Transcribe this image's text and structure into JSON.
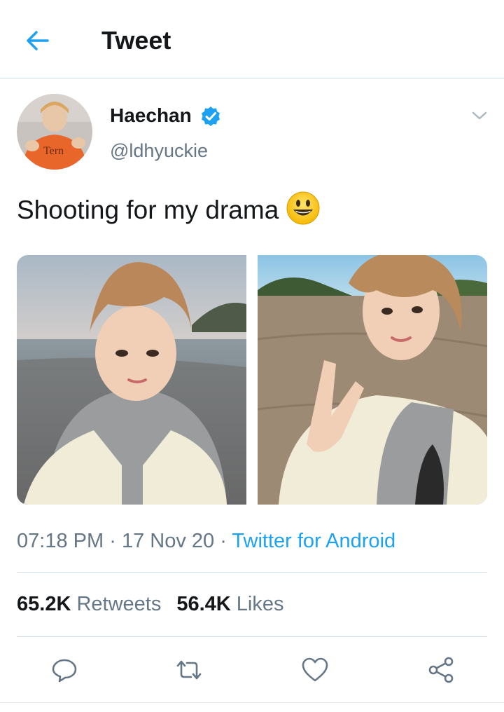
{
  "header": {
    "title": "Tweet",
    "back_icon": "arrow-left-icon"
  },
  "author": {
    "name": "Haechan",
    "handle": "@ldhyuckie",
    "verified": true,
    "verified_icon": "verified-badge-icon",
    "avatar_shirt_text": "Tern"
  },
  "tweet": {
    "text": "Shooting for my drama",
    "emoji": "smiley-face-emoji"
  },
  "meta": {
    "time": "07:18 PM",
    "separator": "·",
    "date": "17 Nov 20",
    "source": "Twitter for Android"
  },
  "stats": {
    "retweets_count": "65.2K",
    "retweets_label": "Retweets",
    "likes_count": "56.4K",
    "likes_label": "Likes"
  },
  "actions": [
    "reply-icon",
    "retweet-icon",
    "like-icon",
    "share-icon"
  ],
  "colors": {
    "accent": "#1da1f2",
    "secondary_text": "#657786",
    "primary_text": "#14171a",
    "divider": "#d3dce3"
  }
}
